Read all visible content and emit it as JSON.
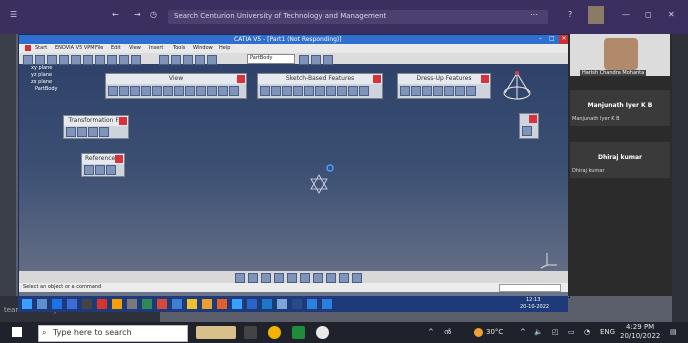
{
  "outer": {
    "search_placeholder": "Search Centurion University of Technology and Management",
    "icons": [
      "hamburger-icon",
      "back-arrow-icon",
      "forward-arrow-icon",
      "history-icon"
    ]
  },
  "catia": {
    "title": "CATIA V5 - [Part1 (Not Responding)]",
    "menu": [
      "Start",
      "ENOVIA V5 VPM",
      "File",
      "Edit",
      "View",
      "Insert",
      "Tools",
      "Window",
      "Help"
    ],
    "body_dropdown": "PartBody",
    "tree": [
      "xy plane",
      "yz plane",
      "zx plane",
      "PartBody"
    ],
    "toolbars": {
      "view": "View",
      "sketch": "Sketch-Based Features",
      "dressup": "Dress-Up Features",
      "transformation": "Transformation F...",
      "reference": "Reference..."
    },
    "status": "Select an object or a command"
  },
  "inner_taskbar": {
    "time": "12:13",
    "date": "20-10-2022"
  },
  "participants": {
    "tile1_name": "Harish Chandra Mohanta",
    "tile2_name": "Manjunath Iyer K B",
    "tile2_sub": "Manjunath Iyer K B",
    "tile3_name": "Dhiraj kumar",
    "tile3_sub": "Dhiraj kumar"
  },
  "left_bottom_text": "team-aetaculty-cutm",
  "taskbar": {
    "search_placeholder": "Type here to search",
    "temperature": "30°C",
    "lang": "ENG",
    "time": "4:29 PM",
    "date": "20/10/2022"
  }
}
